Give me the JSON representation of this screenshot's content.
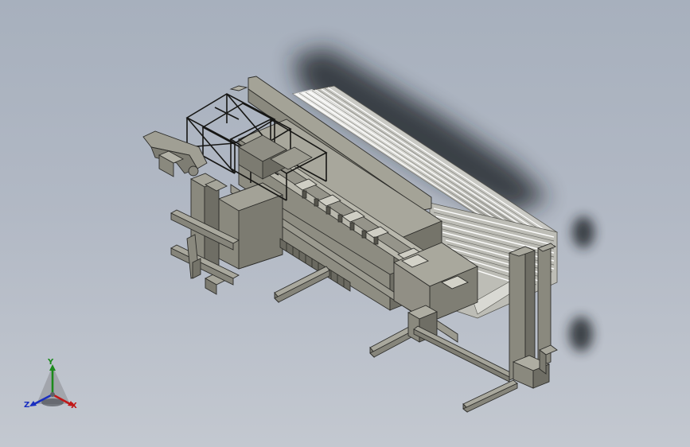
{
  "viewport": {
    "background_top": "#a7b0bd",
    "background_bottom": "#c3c8d0",
    "model_color": "#9c9a8e",
    "edge_color": "#2d2d2a"
  },
  "triad": {
    "x_label": "X",
    "y_label": "Y",
    "z_label": "Z",
    "x_color": "#c01818",
    "y_color": "#1c8a1c",
    "z_color": "#1a2fc0"
  }
}
